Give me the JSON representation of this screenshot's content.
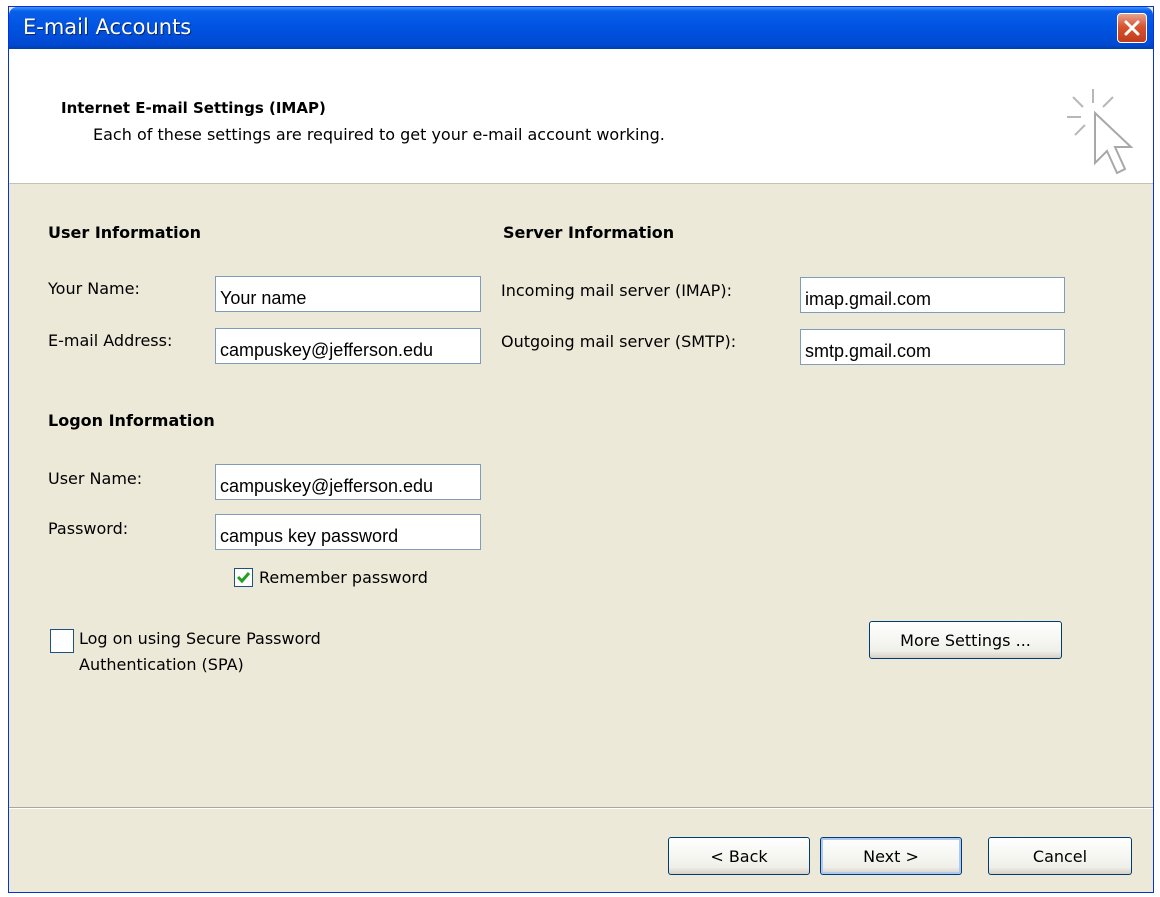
{
  "window": {
    "title": "E-mail Accounts",
    "close_icon": "close-icon"
  },
  "header": {
    "title": "Internet E-mail Settings (IMAP)",
    "subtitle": "Each of these settings are required to get your e-mail account working.",
    "icon": "wizard-cursor-icon"
  },
  "user_info": {
    "heading": "User Information",
    "name_label": "Your Name:",
    "name_value": "Your name",
    "email_label": "E-mail Address:",
    "email_value": "campuskey@jefferson.edu"
  },
  "server_info": {
    "heading": "Server Information",
    "incoming_label": "Incoming mail server (IMAP):",
    "incoming_value": "imap.gmail.com",
    "outgoing_label": "Outgoing mail server (SMTP):",
    "outgoing_value": "smtp.gmail.com"
  },
  "logon_info": {
    "heading": "Logon Information",
    "username_label": "User Name:",
    "username_value": "campuskey@jefferson.edu",
    "password_label": "Password:",
    "password_value": "campus key password",
    "remember_label": "Remember password",
    "remember_checked": true,
    "spa_label_line1": "Log on using Secure Password",
    "spa_label_line2": "Authentication (SPA)",
    "spa_checked": false
  },
  "buttons": {
    "more_settings": "More Settings ...",
    "back": "< Back",
    "next": "Next >",
    "cancel": "Cancel"
  },
  "colors": {
    "titlebar": "#0054e3",
    "dialog_bg": "#ece9d8",
    "close_button": "#d7542f",
    "check_mark": "#21a121"
  }
}
